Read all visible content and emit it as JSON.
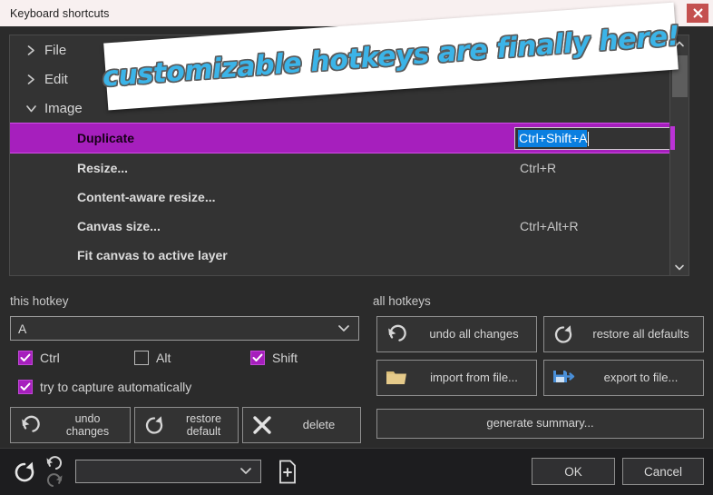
{
  "window": {
    "title": "Keyboard shortcuts",
    "close_icon": "close-icon"
  },
  "banner": {
    "text": "customizable hotkeys are finally here!"
  },
  "tree": {
    "groups": [
      {
        "label": "File",
        "expanded": false,
        "chevron": "chevron-right-icon"
      },
      {
        "label": "Edit",
        "expanded": false,
        "chevron": "chevron-right-icon"
      },
      {
        "label": "Image",
        "expanded": true,
        "chevron": "chevron-down-icon"
      }
    ],
    "items": [
      {
        "name": "Duplicate",
        "shortcut": "Ctrl+Shift+A",
        "selected": true,
        "editing": true
      },
      {
        "name": "Resize...",
        "shortcut": "Ctrl+R",
        "selected": false,
        "editing": false
      },
      {
        "name": "Content-aware resize...",
        "shortcut": "",
        "selected": false,
        "editing": false
      },
      {
        "name": "Canvas size...",
        "shortcut": "Ctrl+Alt+R",
        "selected": false,
        "editing": false
      },
      {
        "name": "Fit canvas to active layer",
        "shortcut": "",
        "selected": false,
        "editing": false
      }
    ],
    "editor_value": "Ctrl+Shift+A",
    "scrollbar": {
      "up_icon": "chevron-up-icon",
      "down_icon": "chevron-down-icon"
    }
  },
  "this_hotkey": {
    "section_label": "this hotkey",
    "key_value": "A",
    "key_dropdown_icon": "chevron-down-icon",
    "modifiers": [
      {
        "label": "Ctrl",
        "checked": true
      },
      {
        "label": "Alt",
        "checked": false
      },
      {
        "label": "Shift",
        "checked": true
      }
    ],
    "auto_capture": {
      "label": "try to capture automatically",
      "checked": true
    },
    "buttons": [
      {
        "line1": "undo",
        "line2": "changes",
        "icon": "undo-icon"
      },
      {
        "line1": "restore",
        "line2": "default",
        "icon": "restore-icon"
      },
      {
        "line1": "delete",
        "line2": "",
        "icon": "delete-x-icon"
      }
    ]
  },
  "all_hotkeys": {
    "section_label": "all hotkeys",
    "buttons": [
      {
        "label": "undo all changes",
        "icon": "undo-icon"
      },
      {
        "label": "restore all defaults",
        "icon": "restore-icon"
      },
      {
        "label": "import from file...",
        "icon": "folder-icon"
      },
      {
        "label": "export to file...",
        "icon": "save-export-icon"
      },
      {
        "label": "generate summary...",
        "icon": ""
      }
    ]
  },
  "bottom_bar": {
    "reset_icon": "reset-icon",
    "undo_icon": "undo-arrow-icon",
    "redo_icon": "redo-arrow-icon",
    "preset_value": "",
    "preset_dropdown_icon": "chevron-down-icon",
    "new_file_icon": "new-file-icon",
    "ok_label": "OK",
    "cancel_label": "Cancel"
  },
  "colors": {
    "accent": "#a61fbd",
    "accent_light": "#d24ee8",
    "selection_blue": "#0a7fe0",
    "banner_text": "#3bb4e8",
    "titlebar_bg": "#f8f0f0",
    "close_red": "#c4504f",
    "folder": "#e2c47e",
    "export_blue": "#4a90d9"
  }
}
